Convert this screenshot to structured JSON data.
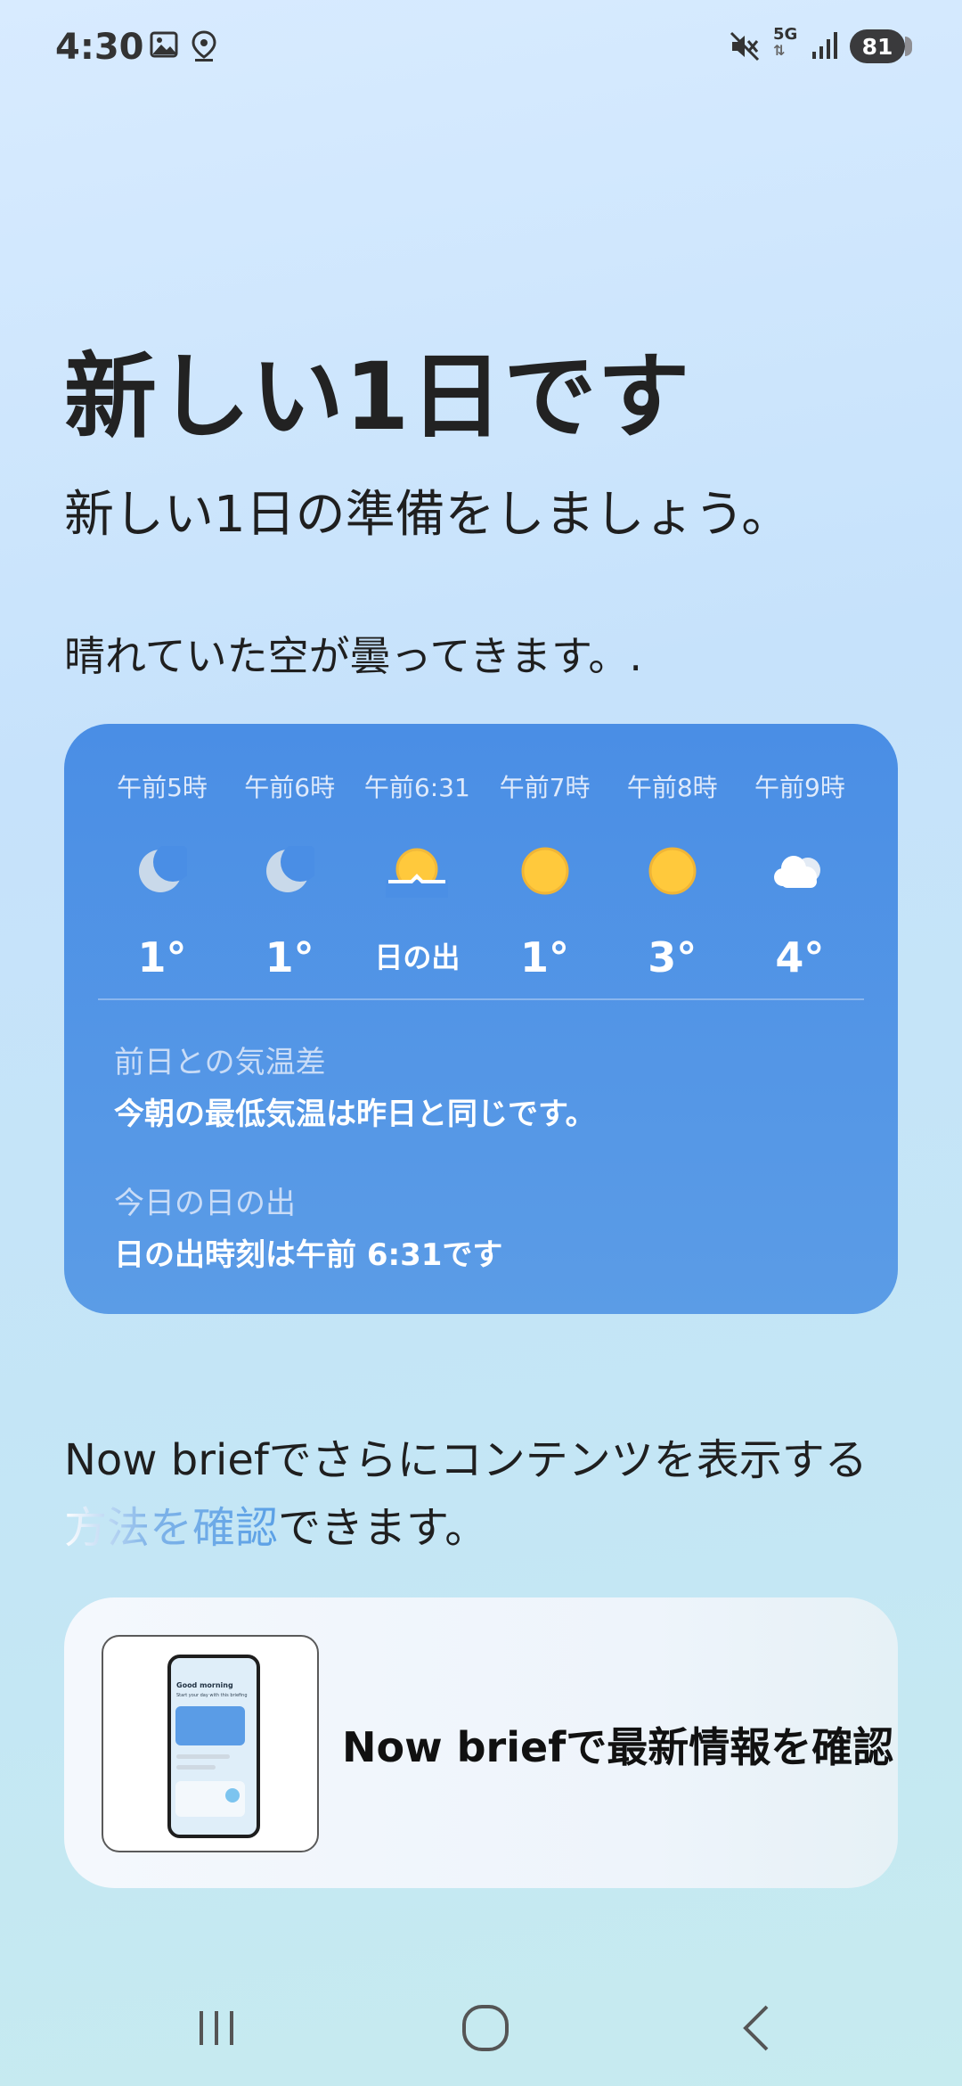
{
  "status_bar": {
    "time": "4:30",
    "network": "5G",
    "battery": "81",
    "icons": [
      "gallery-icon",
      "location-icon",
      "mute-icon",
      "5g-data-icon",
      "signal-icon",
      "battery-icon"
    ]
  },
  "header": {
    "title": "新しい1日です",
    "subtitle": "新しい1日の準備をしましょう。"
  },
  "weather_message": "晴れていた空が曇ってきます。.",
  "weather_card": {
    "hours": [
      {
        "label": "午前5時",
        "icon": "moon-icon",
        "temp": "1°"
      },
      {
        "label": "午前6時",
        "icon": "moon-icon",
        "temp": "1°"
      },
      {
        "label": "午前6:31",
        "icon": "sunrise-icon",
        "temp": "日の出"
      },
      {
        "label": "午前7時",
        "icon": "sun-icon",
        "temp": "1°"
      },
      {
        "label": "午前8時",
        "icon": "sun-icon",
        "temp": "3°"
      },
      {
        "label": "午前9時",
        "icon": "cloud-icon",
        "temp": "4°"
      }
    ],
    "temp_diff_label": "前日との気温差",
    "temp_diff_value": "今朝の最低気温は昨日と同じです。",
    "sunrise_label": "今日の日の出",
    "sunrise_value": "日の出時刻は午前 6:31です"
  },
  "brief": {
    "text_plain": "Now briefでさらにコンテンツを表示する",
    "text_fade": "方法を確認",
    "text_end": "できます。",
    "card_label": "Now briefで最新情報を確認",
    "thumb_greeting": "Good morning",
    "thumb_sub": "Start your day with this briefing"
  },
  "colors": {
    "card_blue": "#4a8ee5",
    "sun": "#ffc93c",
    "moon": "#c9d9ea"
  },
  "nav": {
    "icons": [
      "recents-icon",
      "home-icon",
      "back-icon"
    ]
  }
}
